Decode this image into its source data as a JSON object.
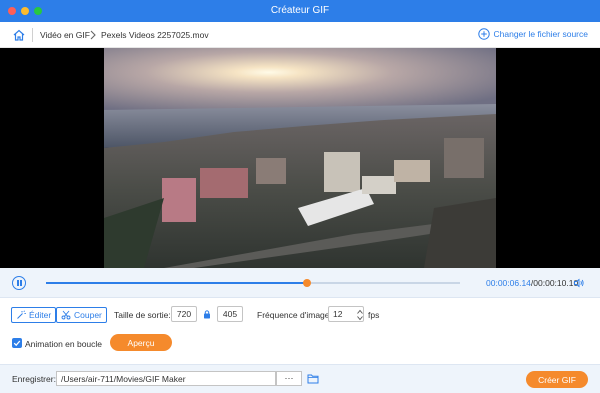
{
  "window": {
    "title": "Créateur GIF"
  },
  "navbar": {
    "crumb_root": "Vidéo en GIF",
    "crumb_file": "Pexels Videos 2257025.mov",
    "change_source": "Changer le fichier source"
  },
  "player": {
    "current_time": "00:00:06.14",
    "separator": "/",
    "total_time": "00:00:10.10",
    "progress": 0.63
  },
  "options": {
    "edit_label": "Éditer",
    "cut_label": "Couper",
    "output_size_label": "Taille de sortie:",
    "width": "720",
    "height": "405",
    "frame_rate_label": "Fréquence d'image:",
    "frame_rate": "12",
    "fps_unit": "fps",
    "loop_label": "Animation en boucle",
    "loop_checked": true,
    "preview_label": "Aperçu"
  },
  "footer": {
    "save_label": "Enregistrer:",
    "save_path": "/Users/air-711/Movies/GIF Maker",
    "browse_label": "···",
    "create_label": "Créer GIF"
  },
  "colors": {
    "accent": "#2d7ee8",
    "orange": "#f58a2c"
  }
}
